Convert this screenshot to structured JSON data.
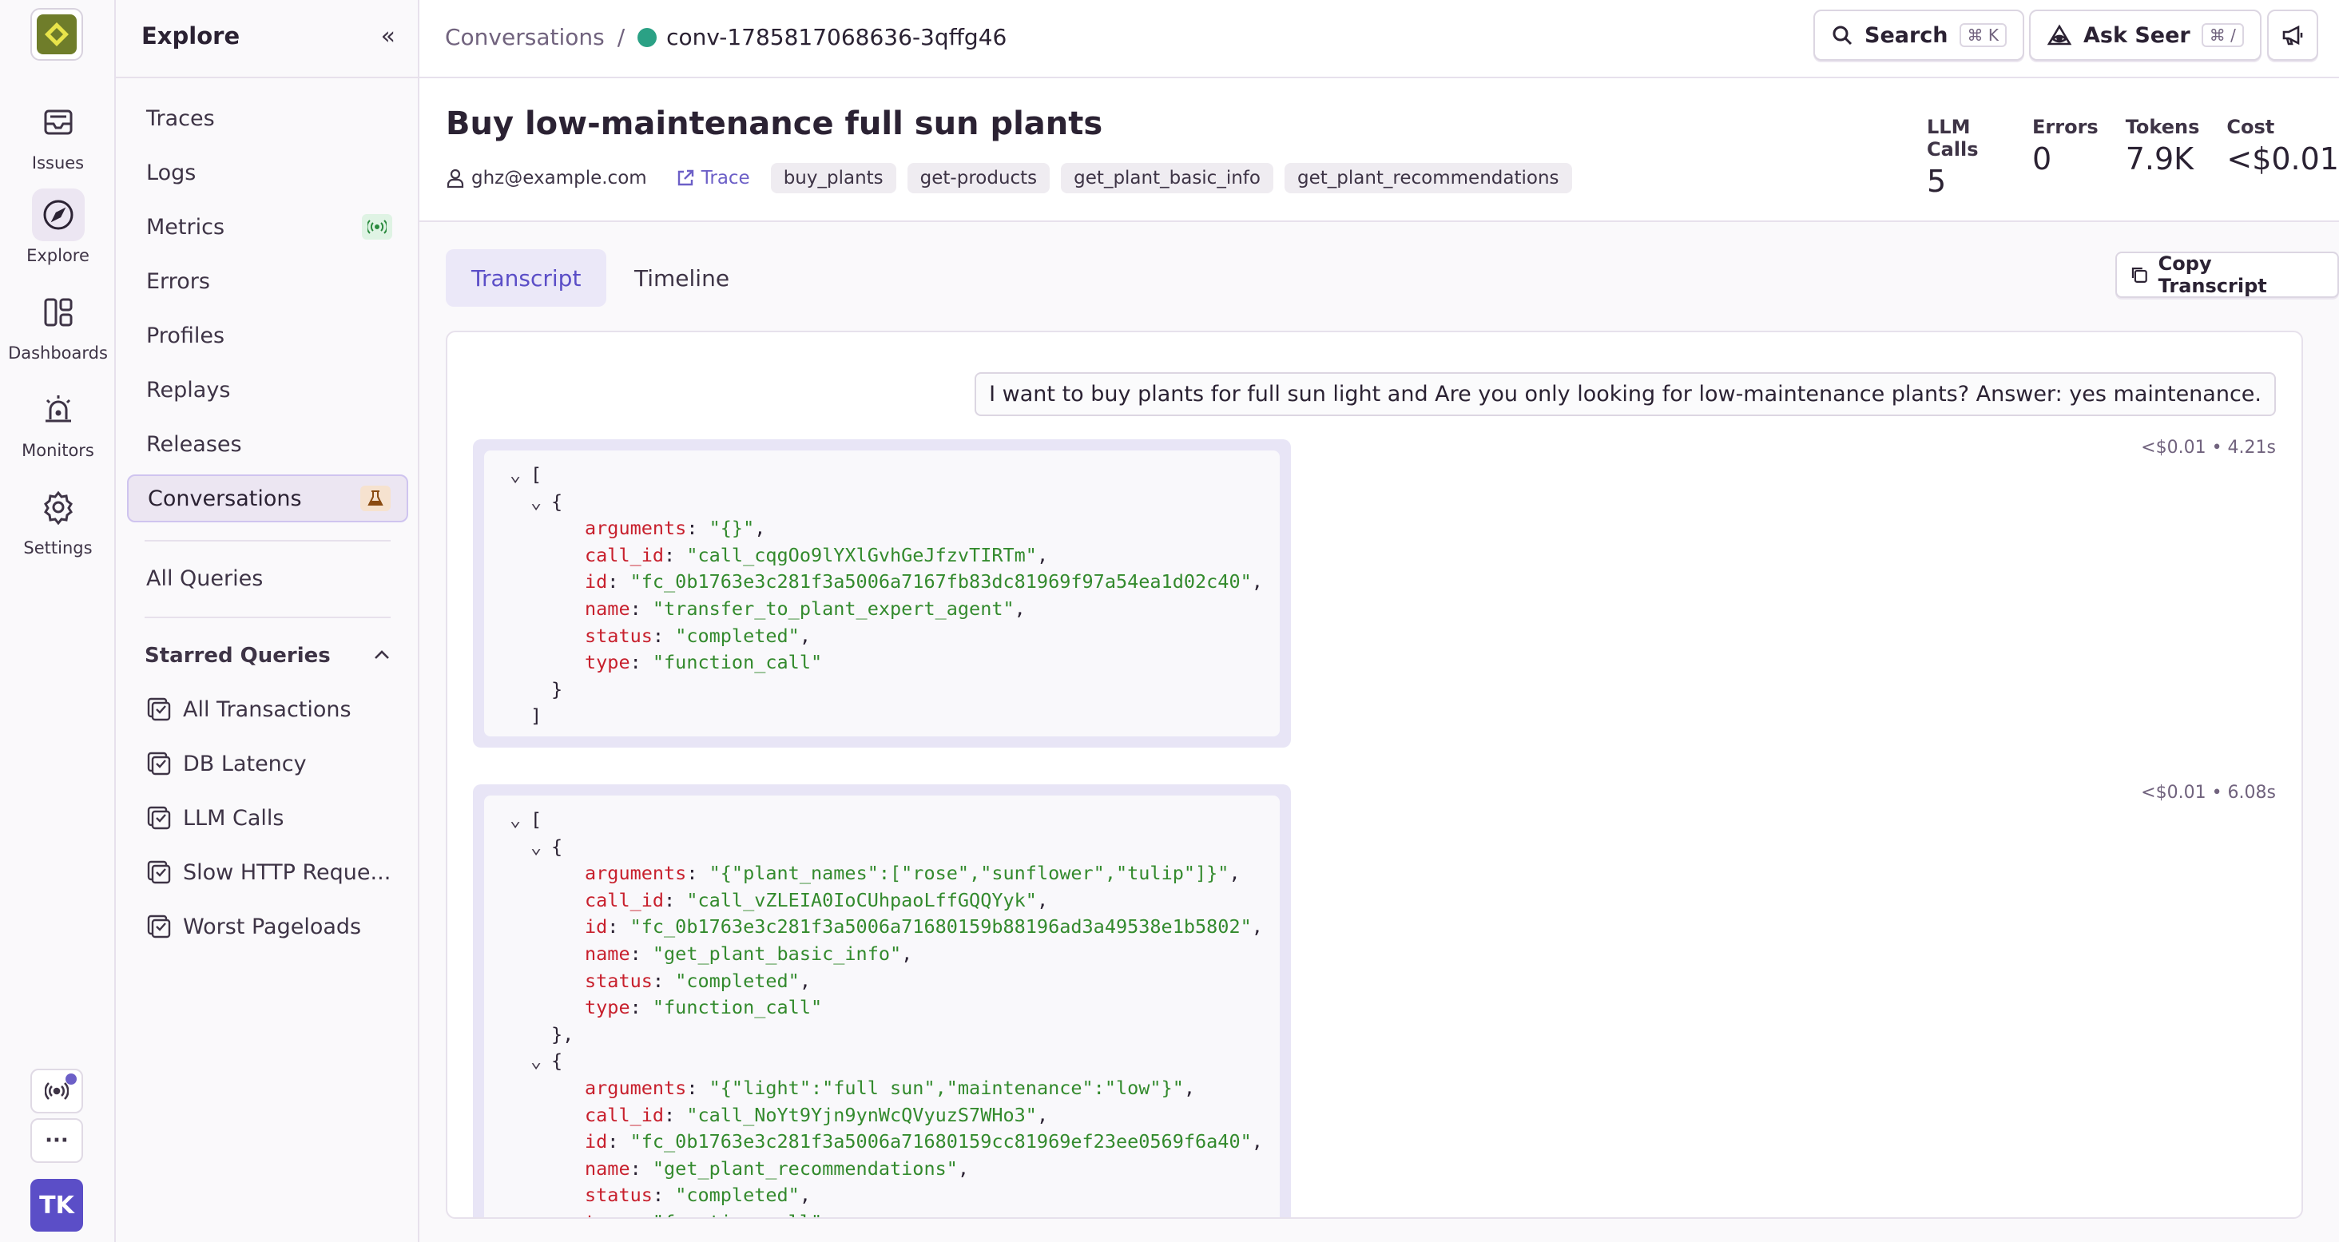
{
  "rail": {
    "items": [
      {
        "label": "Issues",
        "icon": "issues-icon"
      },
      {
        "label": "Explore",
        "icon": "compass-icon"
      },
      {
        "label": "Dashboards",
        "icon": "dashboard-icon"
      },
      {
        "label": "Monitors",
        "icon": "alarm-icon"
      },
      {
        "label": "Settings",
        "icon": "gear-icon"
      }
    ],
    "more_label": "···",
    "avatar_initials": "TK"
  },
  "sidebar": {
    "title": "Explore",
    "collapse_label": "«",
    "items": [
      {
        "label": "Traces"
      },
      {
        "label": "Logs"
      },
      {
        "label": "Metrics"
      },
      {
        "label": "Errors"
      },
      {
        "label": "Profiles"
      },
      {
        "label": "Replays"
      },
      {
        "label": "Releases"
      },
      {
        "label": "Conversations"
      }
    ],
    "all_queries": "All Queries",
    "starred_title": "Starred Queries",
    "starred_items": [
      {
        "label": "All Transactions"
      },
      {
        "label": "DB Latency"
      },
      {
        "label": "LLM Calls"
      },
      {
        "label": "Slow HTTP Reque..."
      },
      {
        "label": "Worst Pageloads"
      }
    ]
  },
  "topbar": {
    "breadcrumb_root": "Conversations",
    "breadcrumb_sep": "/",
    "breadcrumb_current": "conv-1785817068636-3qffg46",
    "search_label": "Search",
    "search_kbd": "⌘ K",
    "seer_label": "Ask Seer",
    "seer_kbd": "⌘ /"
  },
  "header": {
    "title": "Buy low-maintenance full sun plants",
    "user": "ghz@example.com",
    "trace_label": "Trace",
    "tags": [
      "buy_plants",
      "get-products",
      "get_plant_basic_info",
      "get_plant_recommendations"
    ],
    "stats": [
      {
        "label": "LLM Calls",
        "value": "5"
      },
      {
        "label": "Errors",
        "value": "0"
      },
      {
        "label": "Tokens",
        "value": "7.9K"
      },
      {
        "label": "Cost",
        "value": "<$0.01"
      }
    ]
  },
  "tabs": [
    {
      "label": "Transcript",
      "active": true
    },
    {
      "label": "Timeline",
      "active": false
    }
  ],
  "copy_label": "Copy Transcript",
  "transcript": {
    "user_message": "I want to buy plants for full sun light and Are you only looking for low-maintenance plants? Answer: yes maintenance.",
    "msg1_meta": "<$0.01 • 4.21s",
    "msg2_meta": "<$0.01 • 6.08s",
    "call1": {
      "arguments": "\"{}\"",
      "call_id": "\"call_cqgOo9lYXlGvhGeJfzvTIRTm\"",
      "id": "\"fc_0b1763e3c281f3a5006a7167fb83dc81969f97a54ea1d02c40\"",
      "name": "\"transfer_to_plant_expert_agent\"",
      "status": "\"completed\"",
      "type": "\"function_call\""
    },
    "call2": {
      "arguments": "\"{\"plant_names\":[\"rose\",\"sunflower\",\"tulip\"]}\"",
      "call_id": "\"call_vZLEIA0IoCUhpaoLffGQQYyk\"",
      "id": "\"fc_0b1763e3c281f3a5006a71680159b88196ad3a49538e1b5802\"",
      "name": "\"get_plant_basic_info\"",
      "status": "\"completed\"",
      "type": "\"function_call\""
    },
    "call3": {
      "arguments": "\"{\"light\":\"full sun\",\"maintenance\":\"low\"}\"",
      "call_id": "\"call_NoYt9Yjn9ynWcQVyuzS7WHo3\"",
      "id": "\"fc_0b1763e3c281f3a5006a71680159cc81969ef23ee0569f6a40\"",
      "name": "\"get_plant_recommendations\"",
      "status": "\"completed\"",
      "type": "\"function_call\""
    }
  },
  "colors": {
    "accent": "#6c5fc7",
    "json_key": "#c8202d",
    "json_string": "#338a2d",
    "conv_dot": "#2ba185"
  }
}
